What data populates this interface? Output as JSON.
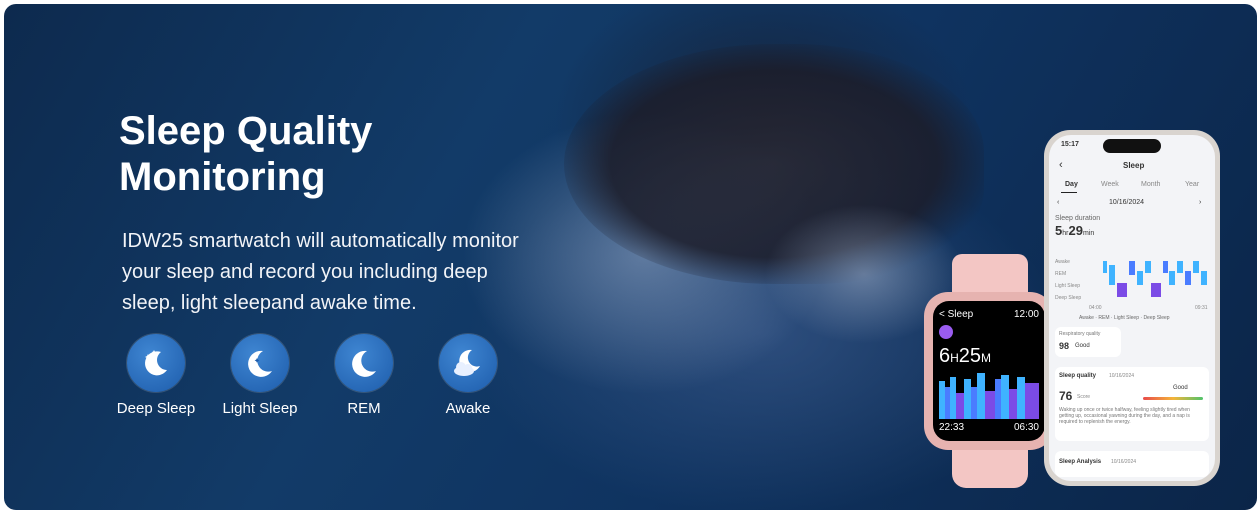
{
  "hero": {
    "title_line1": "Sleep Quality",
    "title_line2": "Monitoring",
    "description_line1": "IDW25 smartwatch will automatically monitor",
    "description_line2": "your sleep and record you including deep",
    "description_line3": "sleep, light sleepand awake time."
  },
  "features": [
    {
      "label": "Deep Sleep",
      "icon": "moon-stars-icon"
    },
    {
      "label": "Light Sleep",
      "icon": "moon-star-icon"
    },
    {
      "label": "REM",
      "icon": "moon-icon"
    },
    {
      "label": "Awake",
      "icon": "moon-cloud-icon"
    }
  ],
  "watch": {
    "back_label": "< Sleep",
    "clock": "12:00",
    "duration_h": "6",
    "duration_h_unit": "H",
    "duration_m": "25",
    "duration_m_unit": "M",
    "start_time": "22:33",
    "end_time": "06:30",
    "colors": {
      "deep": "#7b4be6",
      "light": "#3fb3ff",
      "rem": "#4a7cff"
    }
  },
  "phone": {
    "status_time": "15:17",
    "back_icon": "chevron-left-icon",
    "screen_title": "Sleep",
    "tabs": [
      "Day",
      "Week",
      "Month",
      "Year"
    ],
    "active_tab": "Day",
    "date": "10/16/2024",
    "duration_label": "Sleep duration",
    "duration_h": "5",
    "duration_h_unit": "hr",
    "duration_m": "29",
    "duration_m_unit": "min",
    "stage_labels": [
      "Awake",
      "REM",
      "Light Sleep",
      "Deep Sleep"
    ],
    "chart_start": "04:00",
    "chart_end": "09:31",
    "legend": [
      "Awake",
      "REM",
      "Light Sleep",
      "Deep Sleep"
    ],
    "resp_label": "Respiratory quality",
    "resp_value": "98",
    "resp_status": "Good",
    "quality_label": "Sleep quality",
    "quality_date": "10/16/2024",
    "quality_score": "76",
    "quality_unit": "Score",
    "quality_status": "Good",
    "quality_desc": "Waking up once or twice halfway, feeling slightly tired when getting up, occasional yawning during the day, and a nap is required to replenish the energy.",
    "analysis_label": "Sleep Analysis",
    "analysis_date": "10/16/2024"
  }
}
